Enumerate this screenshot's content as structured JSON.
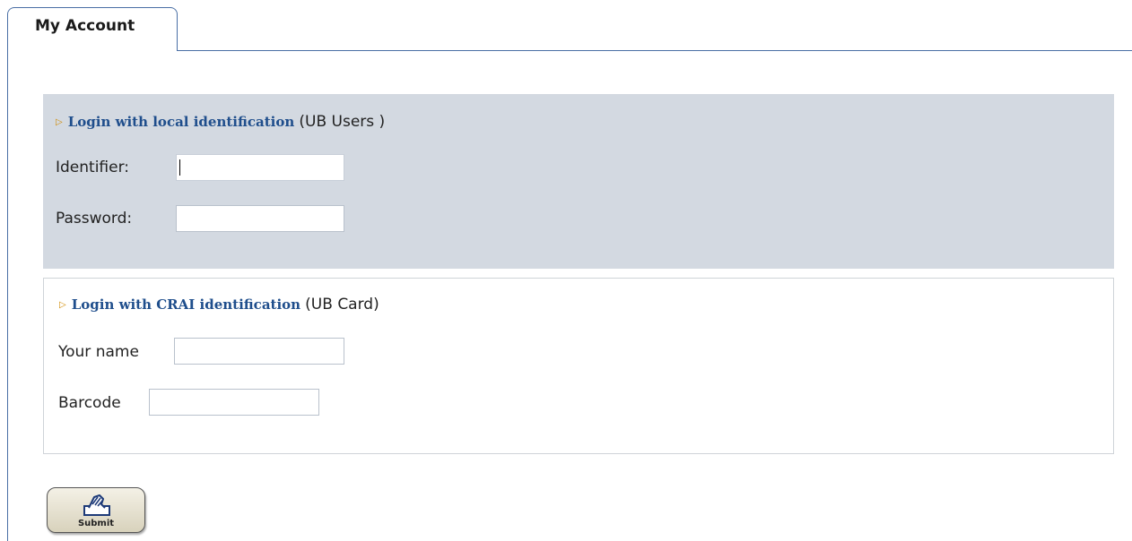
{
  "tabs": {
    "active_label": "My Account"
  },
  "local_login": {
    "arrow_icon": "triangle-right-icon",
    "link_text": "Login with local identification",
    "note": "(UB Users )",
    "identifier_label": "Identifier:",
    "identifier_value": "",
    "password_label": "Password:",
    "password_value": ""
  },
  "crai_login": {
    "arrow_icon": "triangle-right-icon",
    "link_text": "Login with CRAI identification",
    "note": "(UB Card)",
    "name_label": "Your name",
    "name_value": "",
    "barcode_label": "Barcode",
    "barcode_value": ""
  },
  "submit": {
    "icon": "hand-pen-icon",
    "label": "Submit"
  },
  "colors": {
    "tab_border": "#4a6fa5",
    "local_panel_bg": "#d3d9e1",
    "link_color": "#1f4e8c",
    "arrow_color": "#d08a00"
  }
}
